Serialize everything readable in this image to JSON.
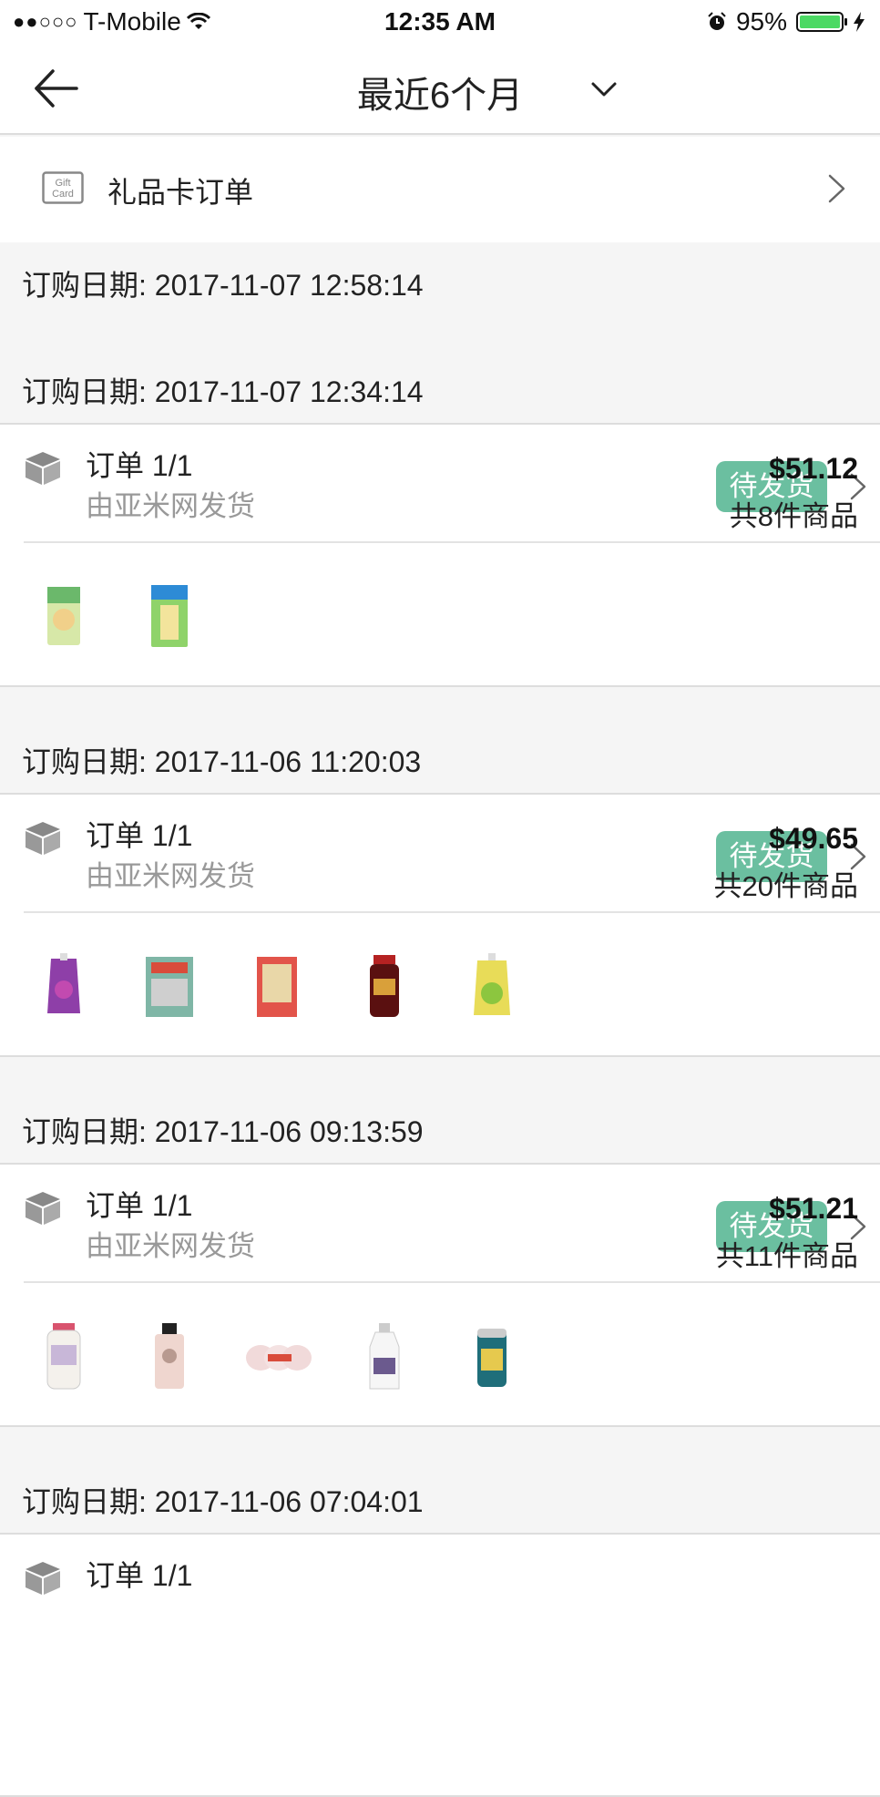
{
  "status_bar": {
    "signal": "●●○○○",
    "carrier": "T-Mobile",
    "time": "12:35 AM",
    "battery": "95%",
    "battery_level": 0.95,
    "battery_color": "#4cd964"
  },
  "nav": {
    "back_icon": "arrow-left-icon",
    "title": "最近6个月",
    "dropdown_icon": "chevron-down-icon"
  },
  "gift_card": {
    "icon_text": "Gift Card",
    "label": "礼品卡订单"
  },
  "colors": {
    "accent": "#6bbfa0",
    "background": "#f5f5f5"
  },
  "orders": [
    {
      "date": "订购日期: 2017-11-07 12:58:14"
    },
    {
      "date": "订购日期: 2017-11-07 12:34:14",
      "order_no": "订单 1/1",
      "shipper": "由亚米网发货",
      "status": "待发货",
      "price": "$51.12",
      "count": "共8件商品",
      "products": [
        "jelly-pack",
        "snack-bag"
      ]
    },
    {
      "date": "订购日期: 2017-11-06 11:20:03",
      "order_no": "订单 1/1",
      "shipper": "由亚米网发货",
      "status": "待发货",
      "price": "$49.65",
      "count": "共20件商品",
      "products": [
        "grape-jelly-pouch",
        "noodle-bag",
        "red-tea-box",
        "chili-sauce-jar",
        "lemon-jelly-pouch"
      ]
    },
    {
      "date": "订购日期: 2017-11-06 09:13:59",
      "order_no": "订单 1/1",
      "shipper": "由亚米网发货",
      "status": "待发货",
      "price": "$51.21",
      "count": "共11件商品",
      "products": [
        "lotion-bottle",
        "shampoo-bottle",
        "snack-cups",
        "milk-lotion-bottle",
        "canned-drink"
      ]
    },
    {
      "date": "订购日期: 2017-11-06 07:04:01",
      "order_no": "订单 1/1"
    }
  ]
}
